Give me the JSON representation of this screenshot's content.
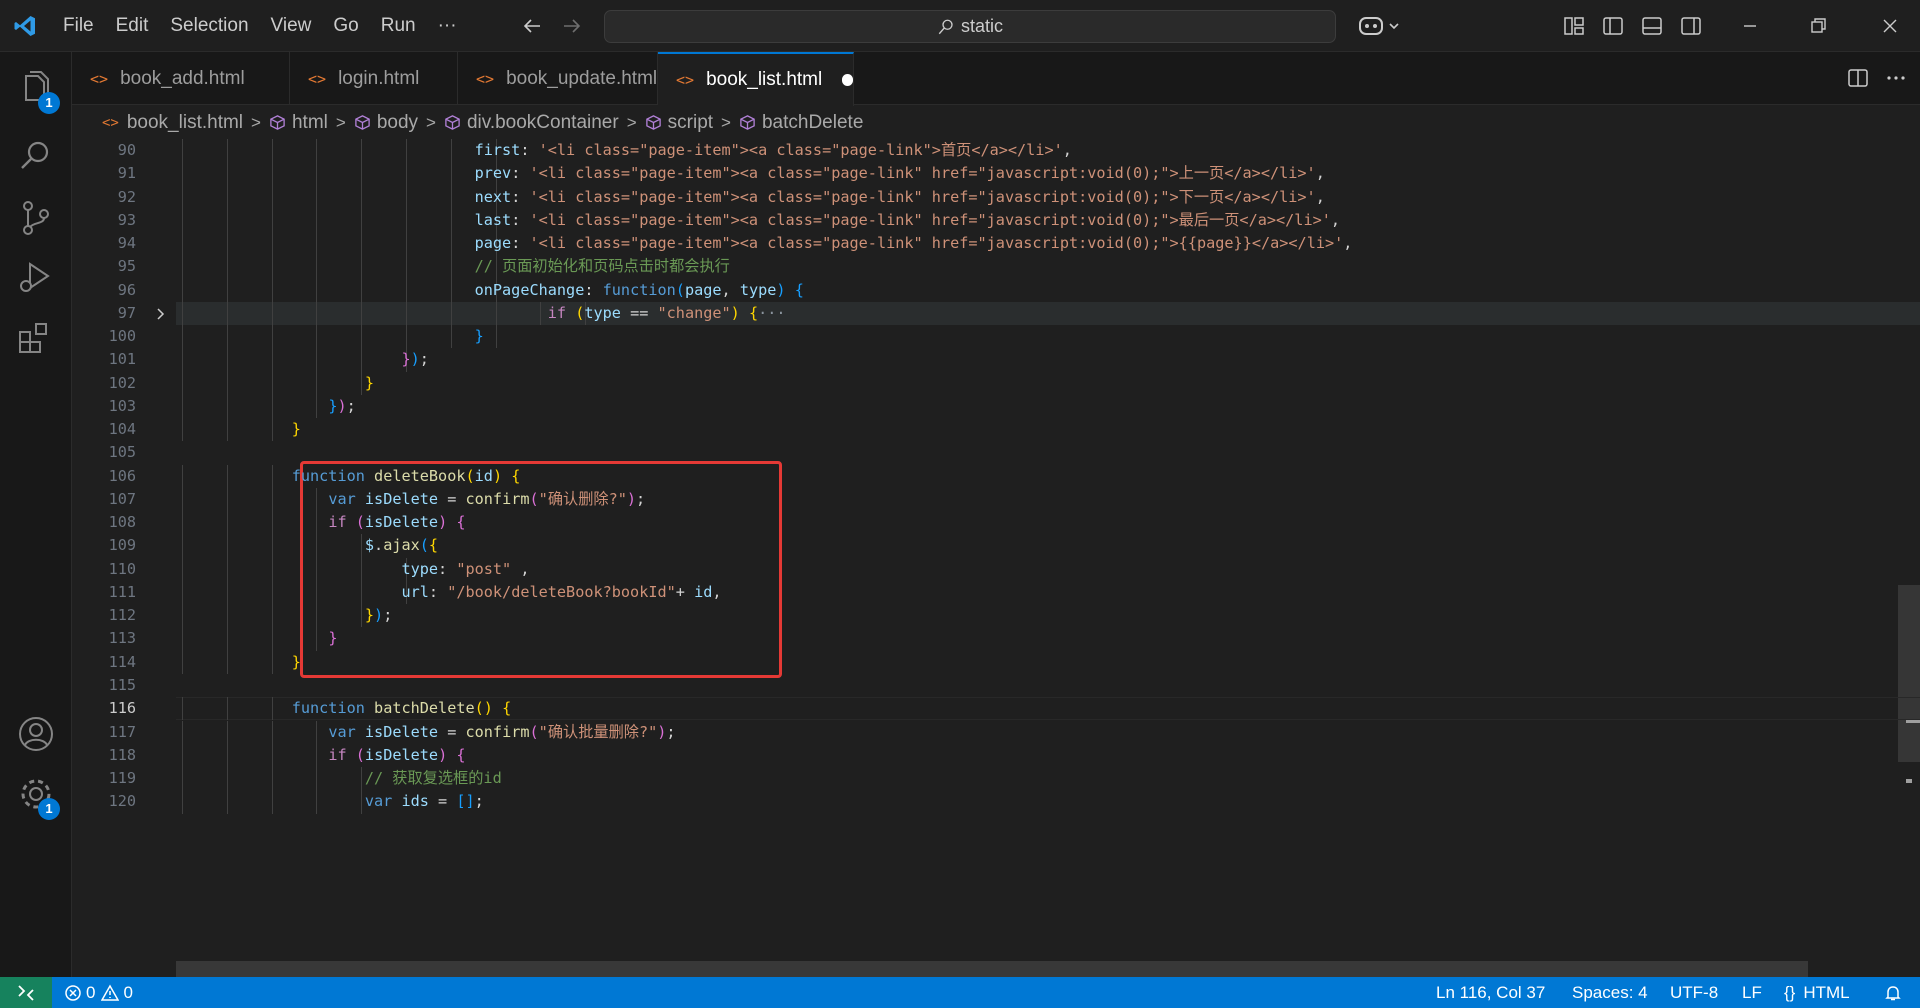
{
  "menu": [
    "File",
    "Edit",
    "Selection",
    "View",
    "Go",
    "Run",
    "···"
  ],
  "search": {
    "text": "static"
  },
  "activity": {
    "explorer_badge": "1",
    "settings_badge": "1"
  },
  "tabs": [
    {
      "label": "book_add.html",
      "icon": "<>"
    },
    {
      "label": "login.html",
      "icon": "<>"
    },
    {
      "label": "book_update.html",
      "icon": "<>"
    },
    {
      "label": "book_list.html",
      "icon": "<>",
      "active": true,
      "modified": true
    }
  ],
  "breadcrumb": {
    "file": "book_list.html",
    "items": [
      "html",
      "body",
      "div.bookContainer",
      "script",
      "batchDelete"
    ]
  },
  "code_lines": [
    {
      "n": "90",
      "tokens": [
        [
          "v",
          "first"
        ],
        [
          "p",
          ": "
        ],
        [
          "s",
          "'<li class=\"page-item\"><a class=\"page-link\">首页</a></li>'"
        ],
        [
          "p",
          ","
        ]
      ],
      "indent": 8
    },
    {
      "n": "91",
      "tokens": [
        [
          "v",
          "prev"
        ],
        [
          "p",
          ": "
        ],
        [
          "s",
          "'<li class=\"page-item\"><a class=\"page-link\" href=\"javascript:void(0);\">上一页</a></li>'"
        ],
        [
          "p",
          ","
        ]
      ],
      "indent": 8
    },
    {
      "n": "92",
      "tokens": [
        [
          "v",
          "next"
        ],
        [
          "p",
          ": "
        ],
        [
          "s",
          "'<li class=\"page-item\"><a class=\"page-link\" href=\"javascript:void(0);\">下一页</a></li>'"
        ],
        [
          "p",
          ","
        ]
      ],
      "indent": 8
    },
    {
      "n": "93",
      "tokens": [
        [
          "v",
          "last"
        ],
        [
          "p",
          ": "
        ],
        [
          "s",
          "'<li class=\"page-item\"><a class=\"page-link\" href=\"javascript:void(0);\">最后一页</a></li>'"
        ],
        [
          "p",
          ","
        ]
      ],
      "indent": 8
    },
    {
      "n": "94",
      "tokens": [
        [
          "v",
          "page"
        ],
        [
          "p",
          ": "
        ],
        [
          "s",
          "'<li class=\"page-item\"><a class=\"page-link\" href=\"javascript:void(0);\">{{page}}</a></li>'"
        ],
        [
          "p",
          ","
        ]
      ],
      "indent": 8
    },
    {
      "n": "95",
      "tokens": [
        [
          "c",
          "// 页面初始化和页码点击时都会执行"
        ]
      ],
      "indent": 8
    },
    {
      "n": "96",
      "tokens": [
        [
          "v",
          "onPageChange"
        ],
        [
          "p",
          ": "
        ],
        [
          "k",
          "function"
        ],
        [
          "b3",
          "("
        ],
        [
          "v",
          "page"
        ],
        [
          "p",
          ", "
        ],
        [
          "v",
          "type"
        ],
        [
          "b3",
          ")"
        ],
        [
          "p",
          " "
        ],
        [
          "b3",
          "{"
        ]
      ],
      "indent": 8
    },
    {
      "n": "97",
      "tokens": [
        [
          "ctl",
          "if"
        ],
        [
          "p",
          " "
        ],
        [
          "b1",
          "("
        ],
        [
          "v",
          "type"
        ],
        [
          "p",
          " == "
        ],
        [
          "s",
          "\"change\""
        ],
        [
          "b1",
          ")"
        ],
        [
          "p",
          " "
        ],
        [
          "b1",
          "{"
        ],
        [
          "fold-dots",
          "···"
        ]
      ],
      "indent": 10,
      "folded": true,
      "highlight": true
    },
    {
      "n": "100",
      "tokens": [
        [
          "b3",
          "}"
        ]
      ],
      "indent": 8
    },
    {
      "n": "101",
      "tokens": [
        [
          "b2",
          "}"
        ],
        [
          "b3",
          ")"
        ],
        [
          "p",
          ";"
        ]
      ],
      "indent": 6
    },
    {
      "n": "102",
      "tokens": [
        [
          "b1",
          "}"
        ]
      ],
      "indent": 5
    },
    {
      "n": "103",
      "tokens": [
        [
          "b3",
          "}"
        ],
        [
          "b2",
          ")"
        ],
        [
          "p",
          ";"
        ]
      ],
      "indent": 4
    },
    {
      "n": "104",
      "tokens": [
        [
          "b1",
          "}"
        ]
      ],
      "indent": 3
    },
    {
      "n": "105",
      "tokens": [],
      "indent": 0
    },
    {
      "n": "106",
      "tokens": [
        [
          "k",
          "function"
        ],
        [
          "p",
          " "
        ],
        [
          "f",
          "deleteBook"
        ],
        [
          "b1",
          "("
        ],
        [
          "v",
          "id"
        ],
        [
          "b1",
          ")"
        ],
        [
          "p",
          " "
        ],
        [
          "b1",
          "{"
        ]
      ],
      "indent": 3
    },
    {
      "n": "107",
      "tokens": [
        [
          "k",
          "var"
        ],
        [
          "p",
          " "
        ],
        [
          "v",
          "isDelete"
        ],
        [
          "p",
          " = "
        ],
        [
          "f",
          "confirm"
        ],
        [
          "b2",
          "("
        ],
        [
          "s",
          "\"确认删除?\""
        ],
        [
          "b2",
          ")"
        ],
        [
          "p",
          ";"
        ]
      ],
      "indent": 4
    },
    {
      "n": "108",
      "tokens": [
        [
          "ctl",
          "if"
        ],
        [
          "p",
          " "
        ],
        [
          "b2",
          "("
        ],
        [
          "v",
          "isDelete"
        ],
        [
          "b2",
          ")"
        ],
        [
          "p",
          " "
        ],
        [
          "b2",
          "{"
        ]
      ],
      "indent": 4
    },
    {
      "n": "109",
      "tokens": [
        [
          "v",
          "$"
        ],
        [
          "p",
          "."
        ],
        [
          "f",
          "ajax"
        ],
        [
          "b3",
          "("
        ],
        [
          "b1",
          "{"
        ]
      ],
      "indent": 5
    },
    {
      "n": "110",
      "tokens": [
        [
          "v",
          "type"
        ],
        [
          "p",
          ": "
        ],
        [
          "s",
          "\"post\""
        ],
        [
          "p",
          " ,"
        ]
      ],
      "indent": 6
    },
    {
      "n": "111",
      "tokens": [
        [
          "v",
          "url"
        ],
        [
          "p",
          ": "
        ],
        [
          "s",
          "\"/book/deleteBook?bookId\""
        ],
        [
          "p",
          "+ "
        ],
        [
          "v",
          "id"
        ],
        [
          "p",
          ","
        ]
      ],
      "indent": 6
    },
    {
      "n": "112",
      "tokens": [
        [
          "b1",
          "}"
        ],
        [
          "b3",
          ")"
        ],
        [
          "p",
          ";"
        ]
      ],
      "indent": 5
    },
    {
      "n": "113",
      "tokens": [
        [
          "b2",
          "}"
        ]
      ],
      "indent": 4
    },
    {
      "n": "114",
      "tokens": [
        [
          "b1",
          "}"
        ]
      ],
      "indent": 3
    },
    {
      "n": "115",
      "tokens": [],
      "indent": 0
    },
    {
      "n": "116",
      "tokens": [
        [
          "k",
          "function"
        ],
        [
          "p",
          " "
        ],
        [
          "f",
          "batchDelete"
        ],
        [
          "b1",
          "("
        ],
        [
          "b1",
          ")"
        ],
        [
          "p",
          " "
        ],
        [
          "b1",
          "{"
        ]
      ],
      "indent": 3,
      "current": true
    },
    {
      "n": "117",
      "tokens": [
        [
          "k",
          "var"
        ],
        [
          "p",
          " "
        ],
        [
          "v",
          "isDelete"
        ],
        [
          "p",
          " = "
        ],
        [
          "f",
          "confirm"
        ],
        [
          "b2",
          "("
        ],
        [
          "s",
          "\"确认批量删除?\""
        ],
        [
          "b2",
          ")"
        ],
        [
          "p",
          ";"
        ]
      ],
      "indent": 4
    },
    {
      "n": "118",
      "tokens": [
        [
          "ctl",
          "if"
        ],
        [
          "p",
          " "
        ],
        [
          "b2",
          "("
        ],
        [
          "v",
          "isDelete"
        ],
        [
          "b2",
          ")"
        ],
        [
          "p",
          " "
        ],
        [
          "b2",
          "{"
        ]
      ],
      "indent": 4
    },
    {
      "n": "119",
      "tokens": [
        [
          "c",
          "// 获取复选框的id"
        ]
      ],
      "indent": 5
    },
    {
      "n": "120",
      "tokens": [
        [
          "k",
          "var"
        ],
        [
          "p",
          " "
        ],
        [
          "v",
          "ids"
        ],
        [
          "p",
          " = "
        ],
        [
          "b3",
          "["
        ],
        [
          "b3",
          "]"
        ],
        [
          "p",
          ";"
        ]
      ],
      "indent": 5
    }
  ],
  "status": {
    "errors": "0",
    "warnings": "0",
    "position": "Ln 116, Col 37",
    "spaces": "Spaces: 4",
    "encoding": "UTF-8",
    "eol": "LF",
    "language": "HTML"
  },
  "colors": {
    "accent": "#0078d4",
    "highlight_box": "#e53935",
    "remote": "#16825d"
  }
}
